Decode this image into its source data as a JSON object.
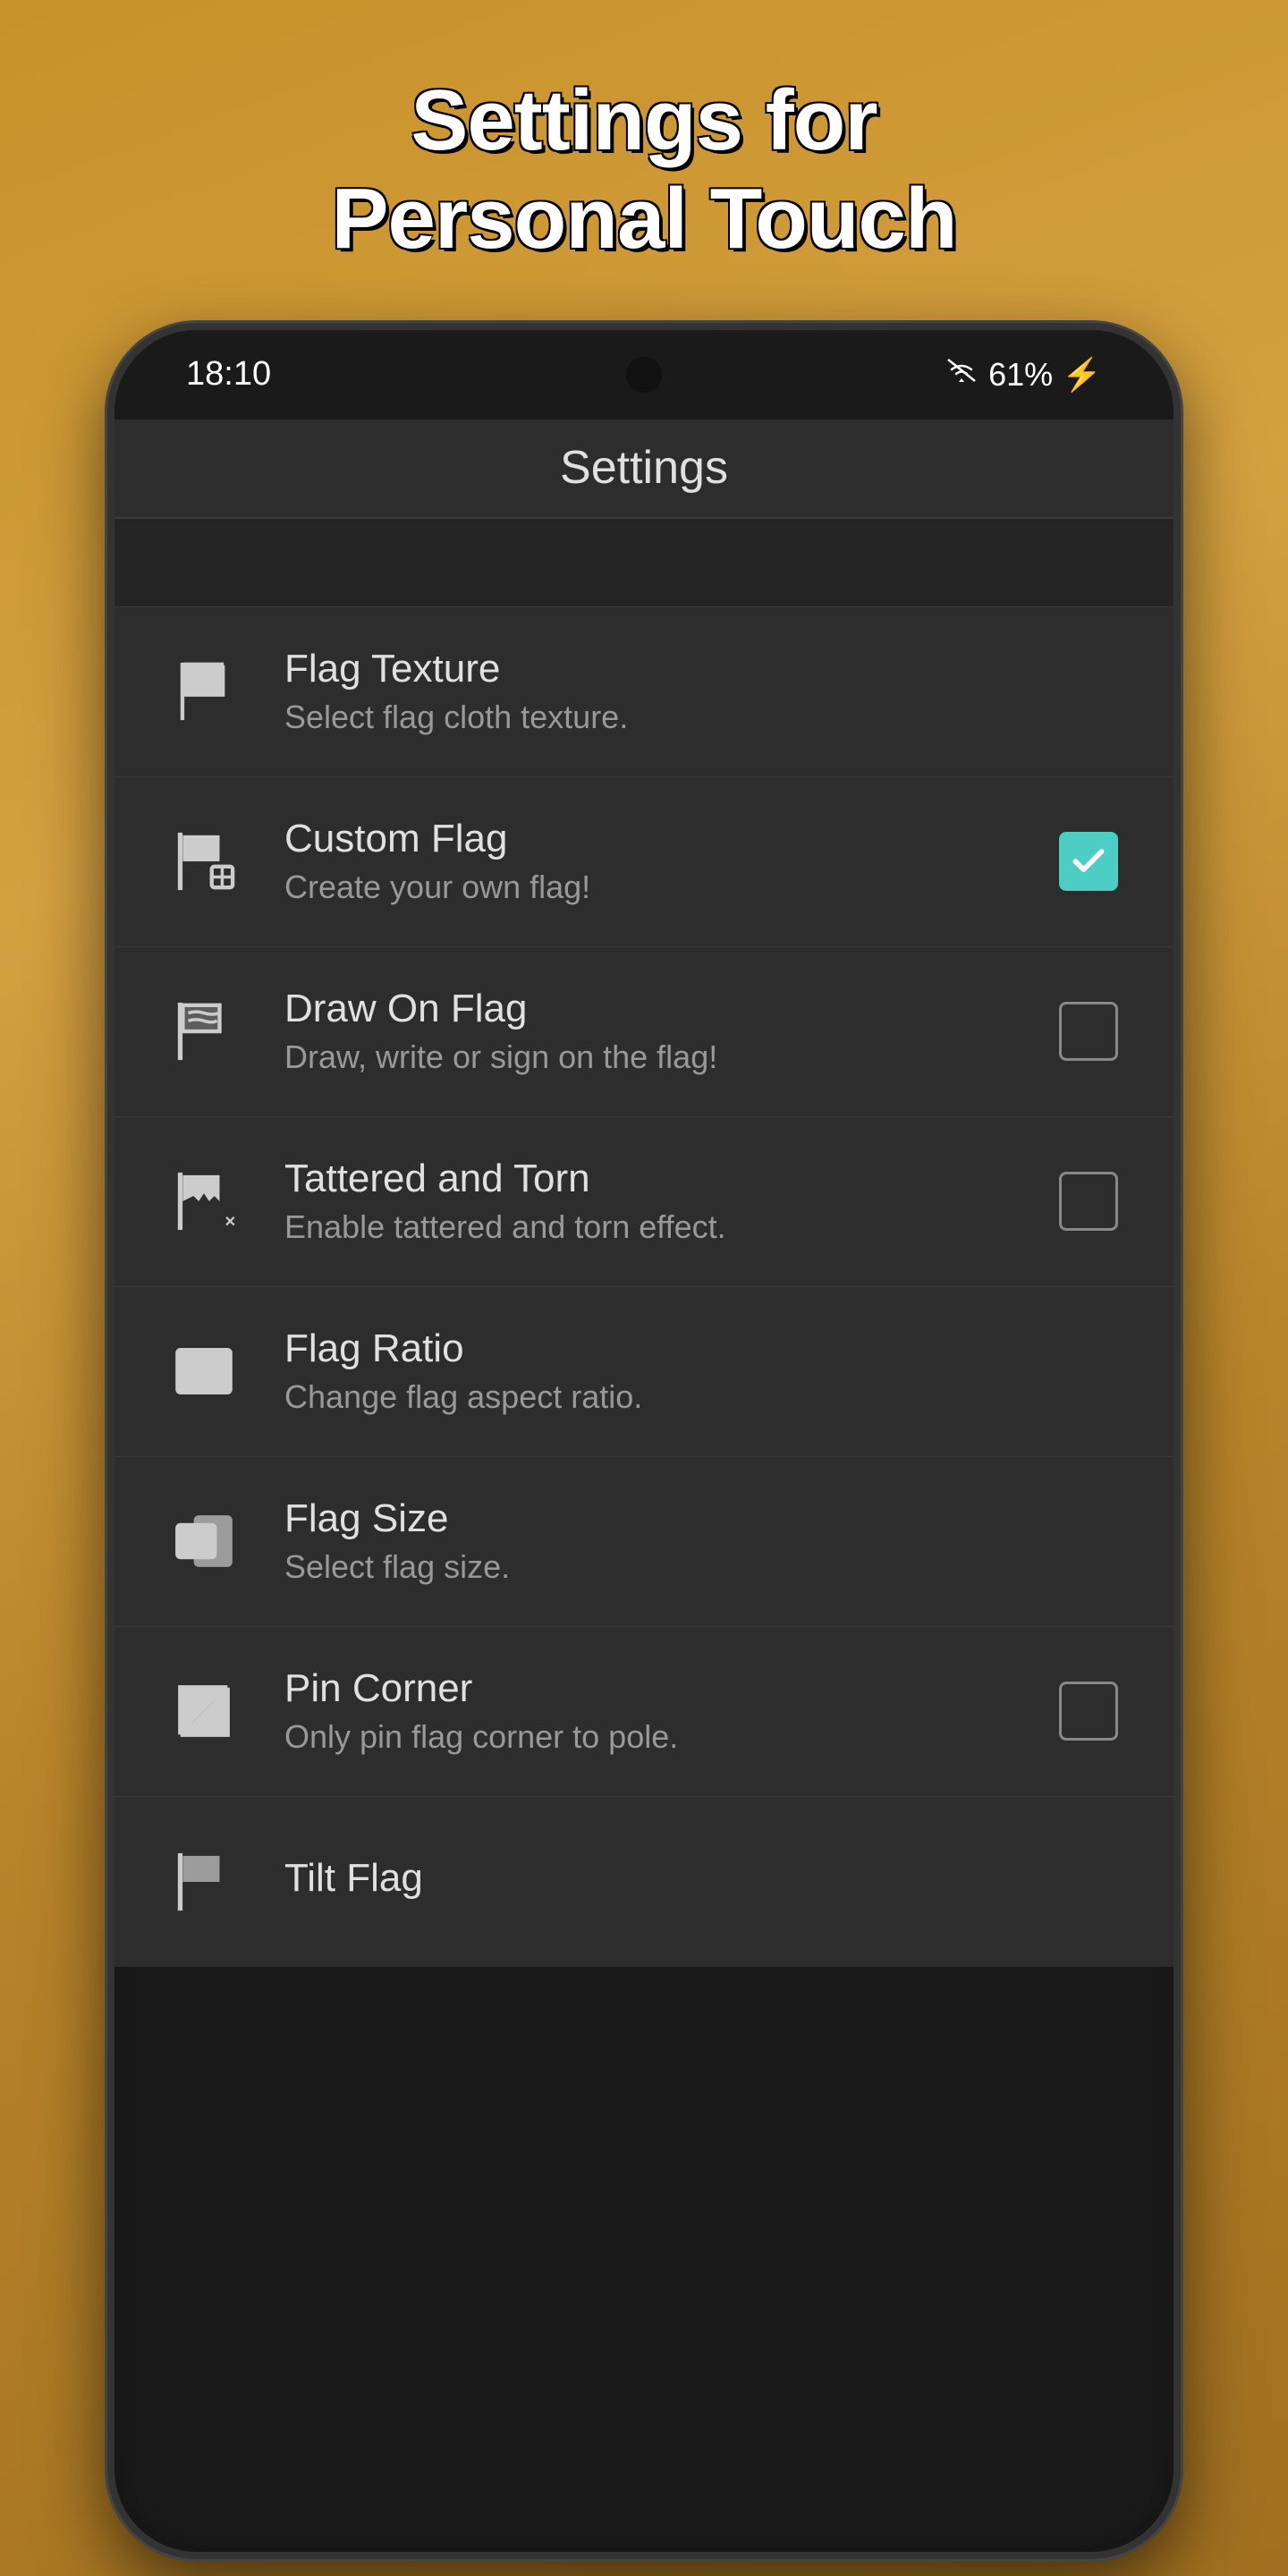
{
  "page": {
    "title_line1": "Settings for",
    "title_line2": "Personal Touch"
  },
  "status_bar": {
    "time": "18:10",
    "battery_percent": "61%",
    "wifi_icon": "wifi-icon",
    "battery_icon": "battery-icon"
  },
  "top_bar": {
    "title": "Settings"
  },
  "settings_items": [
    {
      "id": "flag-texture",
      "icon": "flag-texture-icon",
      "title": "Flag Texture",
      "subtitle": "Select flag cloth texture.",
      "has_checkbox": false,
      "checked": null
    },
    {
      "id": "custom-flag",
      "icon": "custom-flag-icon",
      "title": "Custom Flag",
      "subtitle": "Create your own flag!",
      "has_checkbox": true,
      "checked": true
    },
    {
      "id": "draw-on-flag",
      "icon": "draw-flag-icon",
      "title": "Draw On Flag",
      "subtitle": "Draw, write or sign on the flag!",
      "has_checkbox": true,
      "checked": false
    },
    {
      "id": "tattered-torn",
      "icon": "tattered-icon",
      "title": "Tattered and Torn",
      "subtitle": "Enable tattered and torn effect.",
      "has_checkbox": true,
      "checked": false
    },
    {
      "id": "flag-ratio",
      "icon": "flag-ratio-icon",
      "title": "Flag Ratio",
      "subtitle": "Change flag aspect ratio.",
      "has_checkbox": false,
      "checked": null
    },
    {
      "id": "flag-size",
      "icon": "flag-size-icon",
      "title": "Flag Size",
      "subtitle": "Select flag size.",
      "has_checkbox": false,
      "checked": null
    },
    {
      "id": "pin-corner",
      "icon": "pin-corner-icon",
      "title": "Pin Corner",
      "subtitle": "Only pin flag corner to pole.",
      "has_checkbox": true,
      "checked": false
    },
    {
      "id": "tilt-flag",
      "icon": "tilt-flag-icon",
      "title": "Tilt Flag",
      "subtitle": "",
      "has_checkbox": false,
      "checked": null
    }
  ],
  "colors": {
    "checked_bg": "#4ecdc4",
    "accent": "#4ecdc4"
  }
}
